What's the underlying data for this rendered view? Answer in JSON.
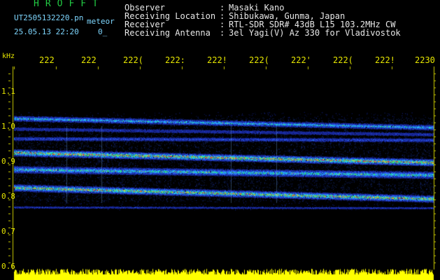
{
  "app_title": "HROFFT",
  "header": {
    "filename": "UT2505132220.pn",
    "meteor_label": "meteor",
    "timestamp": "25.05.13 22:20",
    "counter": "0_"
  },
  "info": [
    {
      "label": "Observer",
      "value": "Masaki Kano"
    },
    {
      "label": "Receiving Location",
      "value": "Shibukawa, Gunma, Japan"
    },
    {
      "label": "Receiver",
      "value": "RTL-SDR SDR# 43dB L15 103.2MHz CW"
    },
    {
      "label": "Receiving Antenna",
      "value": "3el Yagi(V) Az 330 for Vladivostok"
    }
  ],
  "axis": {
    "unit": "kHz",
    "y_ticks": [
      "1.1",
      "1.0",
      "0.9",
      "0.8",
      "0.7",
      "0.6"
    ],
    "time_ticks": [
      "222",
      "222",
      "222(",
      "222:",
      "222!",
      "222(",
      "222'",
      "222(",
      "222!",
      "2230"
    ]
  },
  "colors": {
    "title": "#22cc44",
    "info": "#e8e8e8",
    "axis_label": "#e6e600",
    "background": "#000000",
    "noise_blue": "#1a2aa0",
    "echo_red": "#ff3020",
    "power_bar": "#ffff00"
  }
}
